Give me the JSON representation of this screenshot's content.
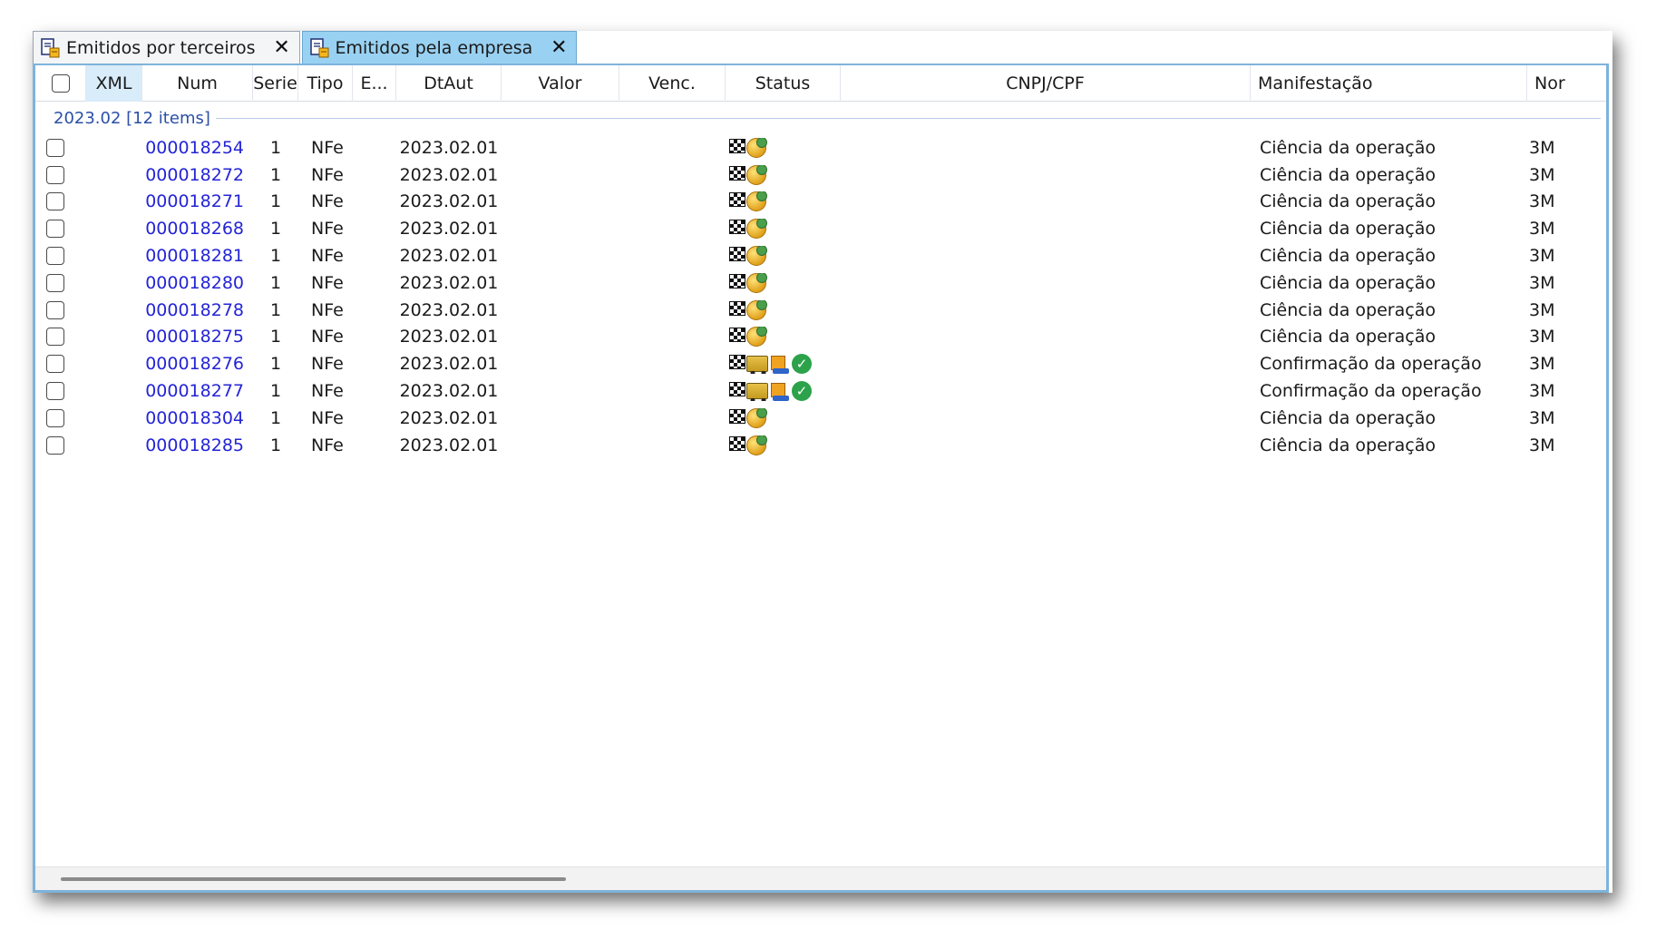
{
  "tabs": [
    {
      "label": "Emitidos por terceiros",
      "active": false,
      "icon": "document-icon"
    },
    {
      "label": "Emitidos pela empresa",
      "active": true,
      "icon": "document-icon"
    }
  ],
  "columns": {
    "xml": "XML",
    "num": "Num",
    "serie": "Serie",
    "tipo": "Tipo",
    "em": "E...",
    "dtaut": "DtAut",
    "valor": "Valor",
    "venc": "Venc.",
    "status": "Status",
    "cnpj": "CNPJ/CPF",
    "manifestacao": "Manifestação",
    "nome": "Nor"
  },
  "group": {
    "label": "2023.02 [12 items]"
  },
  "rows": [
    {
      "num": "000018254",
      "serie": "1",
      "tipo": "NFe",
      "dtaut": "2023.02.01",
      "status": [
        "flag-icon",
        "coin-icon"
      ],
      "manifestacao": "Ciência da operação",
      "nome": "3M"
    },
    {
      "num": "000018272",
      "serie": "1",
      "tipo": "NFe",
      "dtaut": "2023.02.01",
      "status": [
        "flag-icon",
        "coin-icon"
      ],
      "manifestacao": "Ciência da operação",
      "nome": "3M"
    },
    {
      "num": "000018271",
      "serie": "1",
      "tipo": "NFe",
      "dtaut": "2023.02.01",
      "status": [
        "flag-icon",
        "coin-icon"
      ],
      "manifestacao": "Ciência da operação",
      "nome": "3M"
    },
    {
      "num": "000018268",
      "serie": "1",
      "tipo": "NFe",
      "dtaut": "2023.02.01",
      "status": [
        "flag-icon",
        "coin-icon"
      ],
      "manifestacao": "Ciência da operação",
      "nome": "3M"
    },
    {
      "num": "000018281",
      "serie": "1",
      "tipo": "NFe",
      "dtaut": "2023.02.01",
      "status": [
        "flag-icon",
        "coin-icon"
      ],
      "manifestacao": "Ciência da operação",
      "nome": "3M"
    },
    {
      "num": "000018280",
      "serie": "1",
      "tipo": "NFe",
      "dtaut": "2023.02.01",
      "status": [
        "flag-icon",
        "coin-icon"
      ],
      "manifestacao": "Ciência da operação",
      "nome": "3M"
    },
    {
      "num": "000018278",
      "serie": "1",
      "tipo": "NFe",
      "dtaut": "2023.02.01",
      "status": [
        "flag-icon",
        "coin-icon"
      ],
      "manifestacao": "Ciência da operação",
      "nome": "3M"
    },
    {
      "num": "000018275",
      "serie": "1",
      "tipo": "NFe",
      "dtaut": "2023.02.01",
      "status": [
        "flag-icon",
        "coin-icon"
      ],
      "manifestacao": "Ciência da operação",
      "nome": "3M"
    },
    {
      "num": "000018276",
      "serie": "1",
      "tipo": "NFe",
      "dtaut": "2023.02.01",
      "status": [
        "flag-icon",
        "truck-icon",
        "delivery-icon",
        "check-icon"
      ],
      "manifestacao": "Confirmação da operação",
      "nome": "3M"
    },
    {
      "num": "000018277",
      "serie": "1",
      "tipo": "NFe",
      "dtaut": "2023.02.01",
      "status": [
        "flag-icon",
        "truck-icon",
        "delivery-icon",
        "check-icon"
      ],
      "manifestacao": "Confirmação da operação",
      "nome": "3M"
    },
    {
      "num": "000018304",
      "serie": "1",
      "tipo": "NFe",
      "dtaut": "2023.02.01",
      "status": [
        "flag-icon",
        "coin-icon"
      ],
      "manifestacao": "Ciência da operação",
      "nome": "3M"
    },
    {
      "num": "000018285",
      "serie": "1",
      "tipo": "NFe",
      "dtaut": "2023.02.01",
      "status": [
        "flag-icon",
        "coin-icon"
      ],
      "manifestacao": "Ciência da operação",
      "nome": "3M"
    }
  ],
  "colors": {
    "active_tab": "#99d1f2",
    "grid_border": "#7eb3dc",
    "link": "#2424d6",
    "group_label": "#2b4fa8",
    "ok_green": "#2ca24a"
  }
}
